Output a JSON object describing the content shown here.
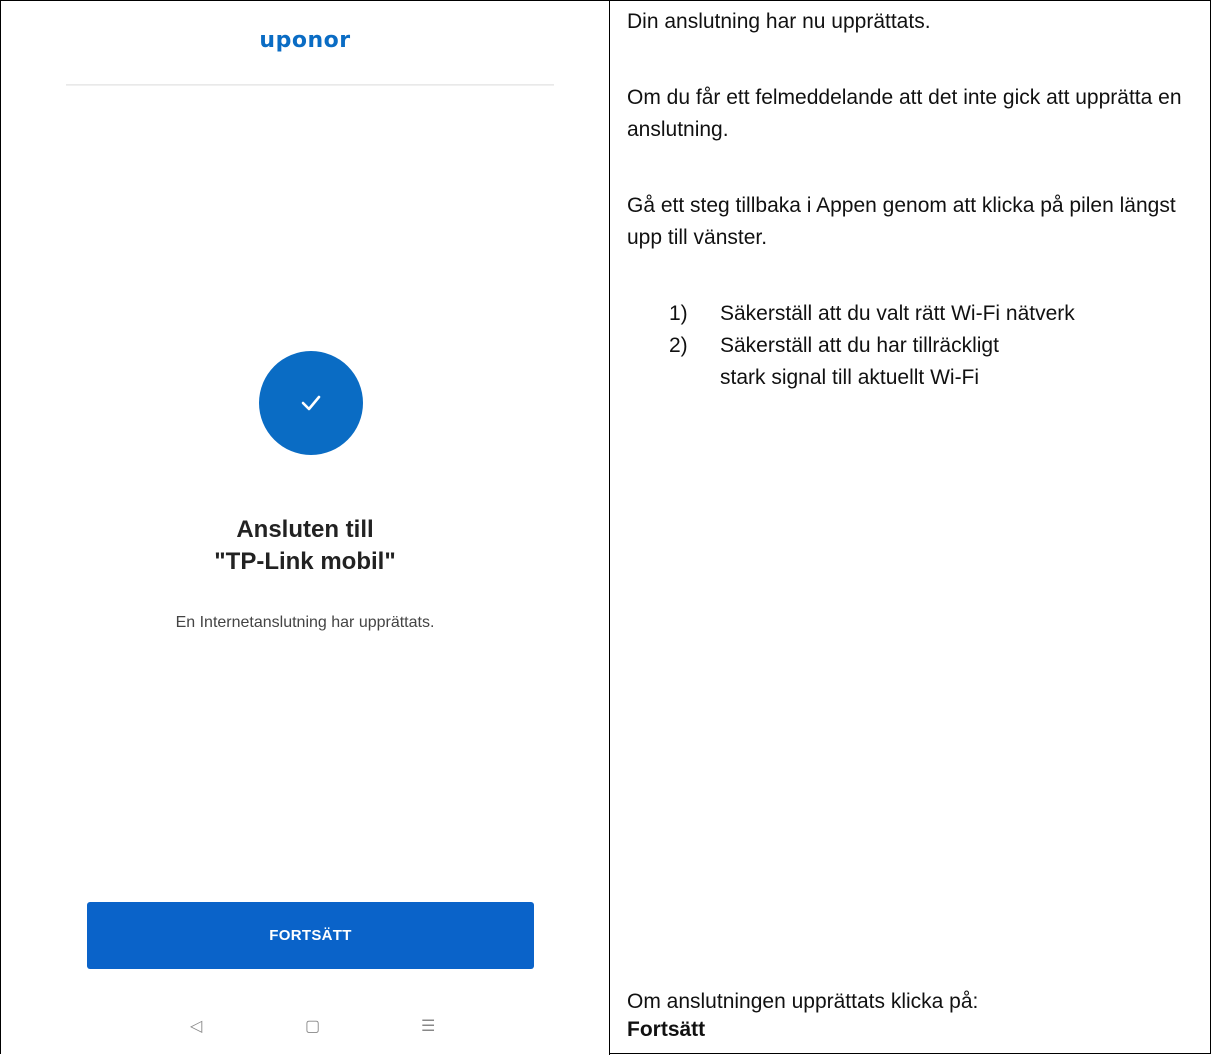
{
  "app": {
    "logo": "uponor",
    "brand_color": "#0a6cc4",
    "status_icon": "checkmark-icon",
    "title_line1": "Ansluten till",
    "title_line2": "\"TP-Link mobil\"",
    "subtitle": "En Internetanslutning har upprättats.",
    "continue_button": "FORTSÄTT",
    "nav": {
      "back_icon": "◁",
      "home_icon": "▢",
      "menu_icon": "☰"
    }
  },
  "instructions": {
    "para1": "Din anslutning har nu upprättats.",
    "para2": "Om du får ett felmeddelande att det inte gick att upprätta en anslutning.",
    "para3": "Gå ett steg tillbaka i Appen genom att klicka på pilen längst upp till vänster.",
    "steps": [
      {
        "num": "1)",
        "text": "Säkerställ att du valt rätt Wi-Fi nätverk"
      },
      {
        "num": "2)",
        "text": "Säkerställ att du har tillräckligt stark signal till aktuellt Wi-Fi"
      }
    ],
    "footer_text": "Om anslutningen upprättats klicka på:",
    "footer_bold": "Fortsätt"
  }
}
